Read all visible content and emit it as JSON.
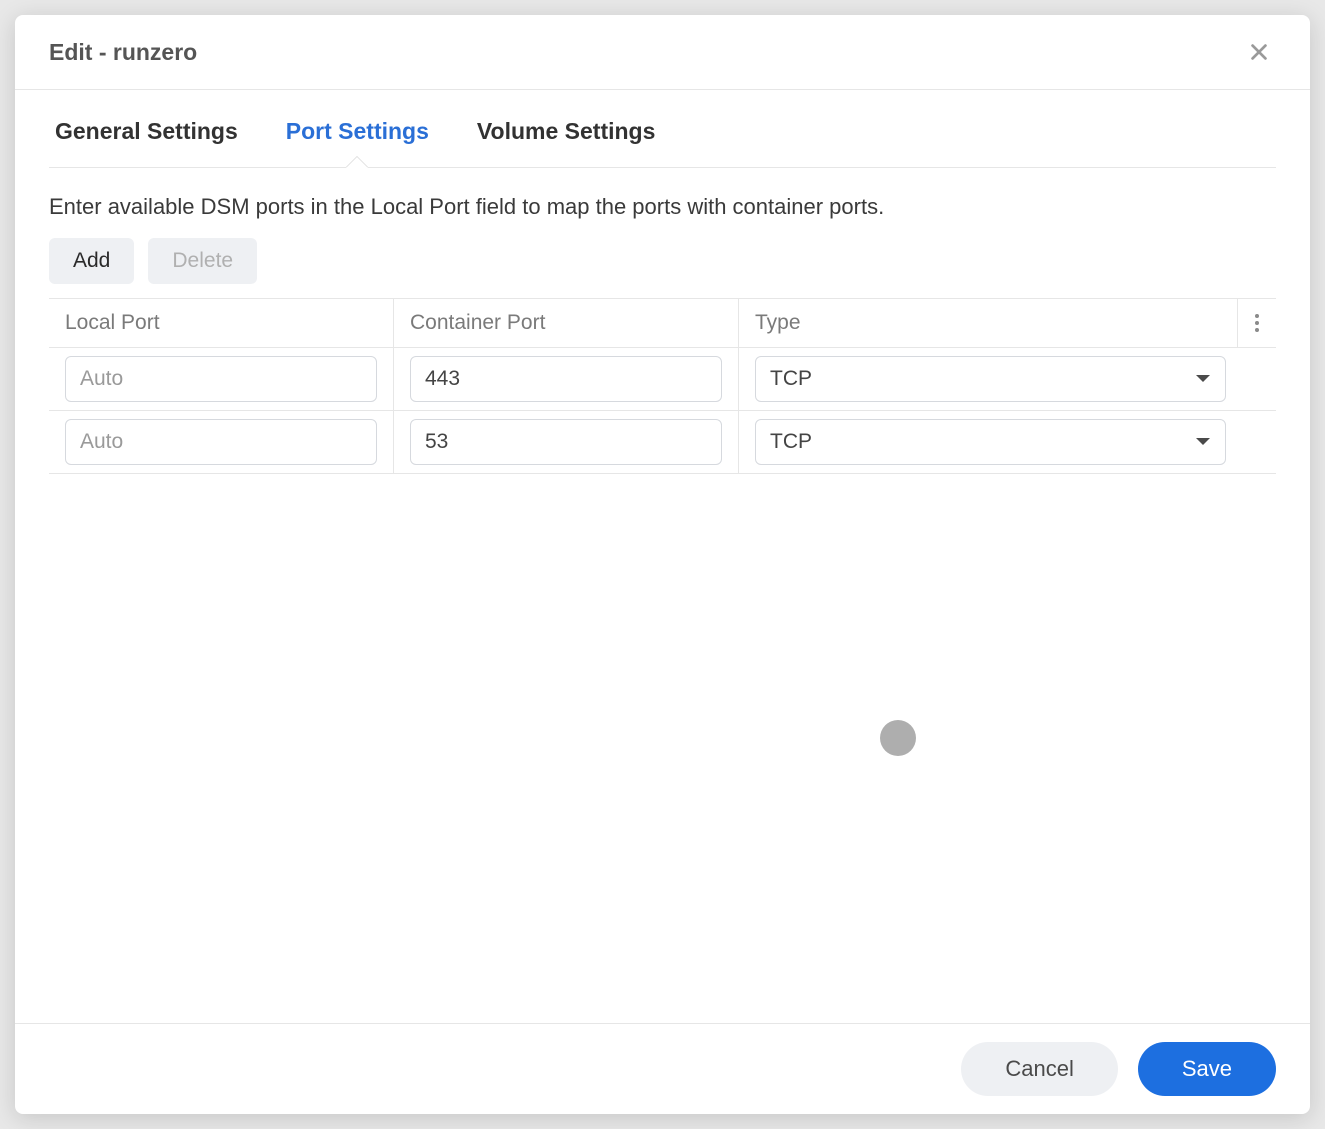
{
  "header": {
    "title": "Edit - runzero"
  },
  "tabs": [
    {
      "label": "General Settings",
      "active": false
    },
    {
      "label": "Port Settings",
      "active": true
    },
    {
      "label": "Volume Settings",
      "active": false
    }
  ],
  "description": "Enter available DSM ports in the Local Port field to map the ports with container ports.",
  "toolbar": {
    "add_label": "Add",
    "delete_label": "Delete"
  },
  "columns": {
    "local": "Local Port",
    "container": "Container Port",
    "type": "Type"
  },
  "rows": [
    {
      "local_placeholder": "Auto",
      "local": "",
      "container": "443",
      "type": "TCP"
    },
    {
      "local_placeholder": "Auto",
      "local": "",
      "container": "53",
      "type": "TCP"
    }
  ],
  "footer": {
    "cancel_label": "Cancel",
    "save_label": "Save"
  }
}
